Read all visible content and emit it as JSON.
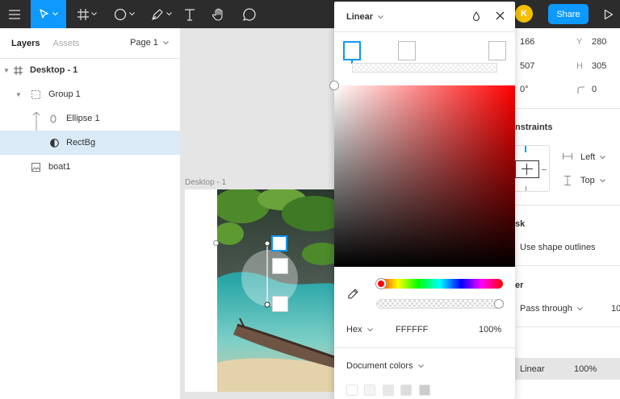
{
  "toolbar": {
    "tools": [
      "menu-icon",
      "move-tool-icon",
      "frame-tool-icon",
      "shape-tool-icon",
      "pen-tool-icon",
      "text-tool-icon",
      "hand-tool-icon",
      "comment-tool-icon"
    ],
    "avatar_initial": "K",
    "share_label": "Share",
    "accent": "#0d99ff"
  },
  "left_panel": {
    "tabs": {
      "layers": "Layers",
      "assets": "Assets"
    },
    "page_selector": "Page 1",
    "layers": [
      {
        "label": "Desktop - 1",
        "icon": "frame-icon"
      },
      {
        "label": "Group 1",
        "icon": "group-icon"
      },
      {
        "label": "Ellipse 1",
        "icon": "ellipse-icon"
      },
      {
        "label": "RectBg",
        "icon": "mask-icon"
      },
      {
        "label": "boat1",
        "icon": "image-icon"
      }
    ]
  },
  "canvas": {
    "frame_label": "Desktop - 1"
  },
  "picker": {
    "fill_type": "Linear",
    "color_format": "Hex",
    "hex_value": "FFFFFF",
    "opacity": "100%",
    "document_colors_label": "Document colors",
    "swatches": [
      "#ffffff",
      "#f4f4f4",
      "#e8e8e8",
      "#dcdcdc",
      "#cccccc"
    ]
  },
  "right_panel": {
    "x": "166",
    "y": "280",
    "w": "507",
    "h": "305",
    "rotation": "0°",
    "corner_radius": "0",
    "constraints_title": "nstraints",
    "constraint_h": "Left",
    "constraint_v": "Top",
    "mask_title": "sk",
    "mask_option": "Use shape outlines",
    "layer_title": "er",
    "blend_mode": "Pass through",
    "layer_opacity": "10",
    "fill_type": "Linear",
    "fill_opacity": "100%"
  }
}
